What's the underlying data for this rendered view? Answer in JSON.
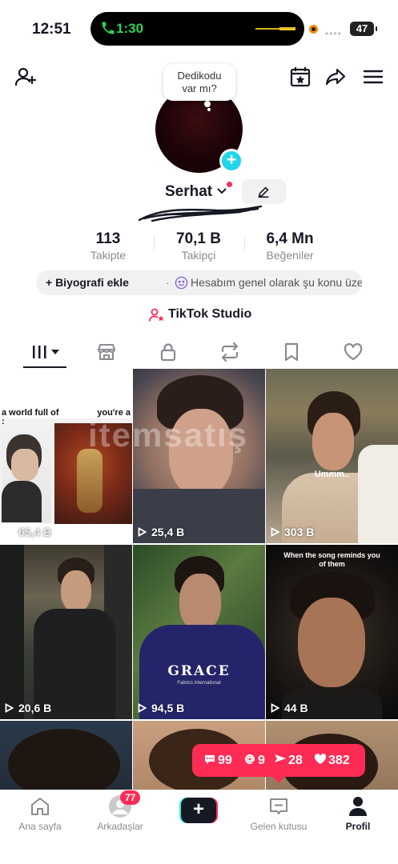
{
  "status_bar": {
    "time": "12:51",
    "call_time": "1:30",
    "battery": "47"
  },
  "bubble": {
    "line1": "Dedikodu",
    "line2": "var mı?"
  },
  "profile": {
    "username": "Serhat"
  },
  "stats": [
    {
      "value": "113",
      "label": "Takipte"
    },
    {
      "value": "70,1 B",
      "label": "Takipçi"
    },
    {
      "value": "6,4 Mn",
      "label": "Beğeniler"
    }
  ],
  "bio": {
    "add_label": "+ Biyografi ekle",
    "separator": "·",
    "suggestion": "Hesabım genel olarak şu konu üzer..."
  },
  "studio": {
    "label": "TikTok Studio"
  },
  "videos": [
    {
      "views": "65,4 B",
      "caption_left": "a world full of :",
      "caption_right": "you're a"
    },
    {
      "views": "25,4 B"
    },
    {
      "views": "303 B",
      "caption": "Ummm.."
    },
    {
      "views": "20,6 B"
    },
    {
      "views": "94,5 B",
      "logo": "GRACE",
      "logo_sub": "Fabrics International"
    },
    {
      "views": "44 B",
      "caption": "When the song reminds you of them"
    }
  ],
  "watermark": "itemsatış",
  "notifications": {
    "comments": "99",
    "mentions": "9",
    "shares": "28",
    "likes": "382"
  },
  "nav": {
    "home": "Ana sayfa",
    "friends": "Arkadaşlar",
    "friends_badge": "77",
    "inbox": "Gelen kutusu",
    "profile": "Profil"
  }
}
